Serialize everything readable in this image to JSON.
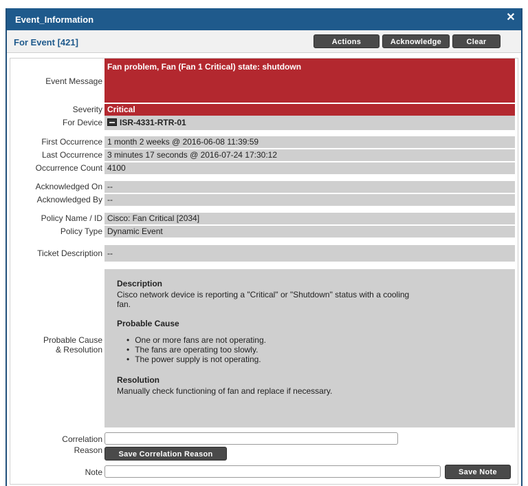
{
  "window": {
    "title": "Event_Information",
    "close_glyph": "✕"
  },
  "header": {
    "event_label": "For Event [421]",
    "actions_label": "Actions",
    "acknowledge_label": "Acknowledge",
    "clear_label": "Clear"
  },
  "fields": {
    "event_message_label": "Event Message",
    "event_message": "Fan problem, Fan (Fan 1 Critical) state: shutdown",
    "severity_label": "Severity",
    "severity": "Critical",
    "for_device_label": "For Device",
    "device_icon": "device-icon",
    "for_device": "ISR-4331-RTR-01",
    "first_occurrence_label": "First Occurrence",
    "first_occurrence": "1 month 2 weeks @ 2016-06-08 11:39:59",
    "last_occurrence_label": "Last Occurrence",
    "last_occurrence": "3 minutes 17 seconds @ 2016-07-24 17:30:12",
    "occurrence_count_label": "Occurrence Count",
    "occurrence_count": "4100",
    "acknowledged_on_label": "Acknowledged On",
    "acknowledged_on": "--",
    "acknowledged_by_label": "Acknowledged By",
    "acknowledged_by": "--",
    "policy_name_label": "Policy Name / ID",
    "policy_name": "Cisco: Fan Critical [2034]",
    "policy_type_label": "Policy Type",
    "policy_type": "Dynamic Event",
    "ticket_description_label": "Ticket Description",
    "ticket_description": "--",
    "probable_cause_label_1": "Probable Cause",
    "probable_cause_label_2": "& Resolution"
  },
  "resolution": {
    "description_heading": "Description",
    "description_line_1": "Cisco network device is reporting a \"Critical\" or \"Shutdown\"  status with a cooling",
    "description_line_2": "fan.",
    "cause_heading": "Probable Cause",
    "causes": [
      "One or more fans are not operating.",
      "The fans are operating too slowly.",
      "The power supply is not operating."
    ],
    "resolution_heading": "Resolution",
    "resolution_text": "Manually check functioning of fan and replace if necessary."
  },
  "footer": {
    "correlation_label_1": "Correlation",
    "correlation_label_2": "Reason",
    "correlation_value": "",
    "save_correlation_label": "Save Correlation Reason",
    "note_label": "Note",
    "note_value": "",
    "save_note_label": "Save Note"
  },
  "colors": {
    "titlebar": "#1f5a8c",
    "critical_red": "#b3282f",
    "field_gray": "#cfcfcf",
    "button_dark": "#4a4a4a"
  }
}
